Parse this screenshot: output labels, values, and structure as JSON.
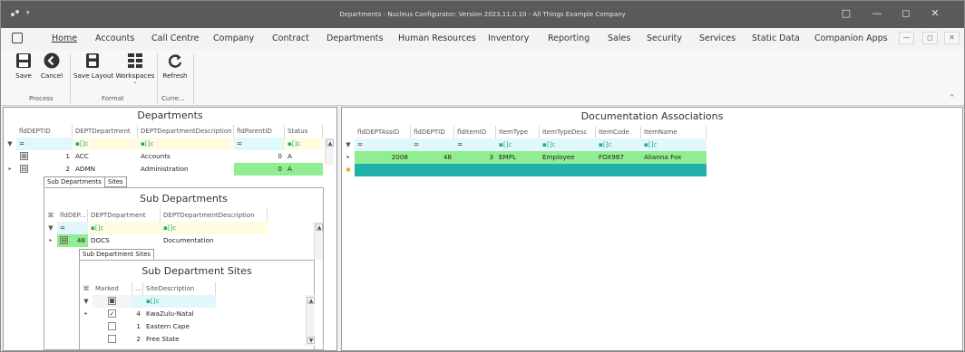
{
  "window": {
    "title": "Departments - Nucleus Configurator: Version 2023.11.0.10 - All Things Example Company",
    "controls": {
      "restore": "□",
      "minimize": "—",
      "maximize": "◻",
      "close": "✕"
    }
  },
  "menu": {
    "items": [
      "Home",
      "Accounts",
      "Call Centre",
      "Company",
      "Contract",
      "Departments",
      "Human Resources",
      "Inventory",
      "Reporting",
      "Sales",
      "Security",
      "Services",
      "Static Data",
      "Companion Apps"
    ],
    "mdi": [
      "—",
      "◻",
      "✕"
    ]
  },
  "ribbon": {
    "buttons": {
      "save": "Save",
      "cancel": "Cancel",
      "save_layout": "Save Layout",
      "workspaces": "Workspaces",
      "refresh": "Refresh"
    },
    "groups": {
      "process": "Process",
      "format": "Format",
      "current": "Curre..."
    },
    "collapse": "^"
  },
  "departments": {
    "title": "Departments",
    "columns": [
      "fldDEPTID",
      "DEPTDepartment",
      "DEPTDepartmentDescription",
      "fldParentID",
      "Status"
    ],
    "filter": {
      "eq": "=",
      "abc": "▪[]c"
    },
    "rows": [
      {
        "id": "1",
        "dept": "ACC",
        "desc": "Accounts",
        "parent": "0",
        "status": "A"
      },
      {
        "id": "2",
        "dept": "ADMN",
        "desc": "Administration",
        "parent": "0",
        "status": "A"
      }
    ],
    "expanders": [
      "⊞",
      "⊟"
    ]
  },
  "sub_tabs": {
    "sub_departments": "Sub Departments",
    "sites": "Sites"
  },
  "sub_departments": {
    "title": "Sub Departments",
    "columns": [
      "fldDEP...",
      "DEPTDepartment",
      "DEPTDepartmentDescription"
    ],
    "rows": [
      {
        "id": "48",
        "dept": "DOCS",
        "desc": "Documentation"
      }
    ]
  },
  "sub_dept_sites_tab": "Sub Department Sites",
  "sub_department_sites": {
    "title": "Sub Department Sites",
    "columns": [
      "Marked",
      "...",
      "SiteDescription"
    ],
    "rows": [
      {
        "marked": true,
        "num": "4",
        "desc": "KwaZulu-Natal"
      },
      {
        "marked": false,
        "num": "1",
        "desc": "Eastern Cape"
      },
      {
        "marked": false,
        "num": "2",
        "desc": "Free State"
      }
    ]
  },
  "documentation": {
    "title": "Documentation Associations",
    "columns": [
      "fldDEPTAssID",
      "fldDEPTID",
      "fldItemID",
      "ItemType",
      "ItemTypeDesc",
      "ItemCode",
      "ItemName"
    ],
    "rows": [
      {
        "assid": "2008",
        "deptid": "48",
        "itemid": "3",
        "type": "EMPL",
        "typedesc": "Employee",
        "code": "FOX967",
        "name": "Alianna Fox"
      }
    ],
    "new_row_marker": "✱"
  },
  "colors": {
    "green": "#90ee90",
    "filter_yellow": "#fffce0",
    "filter_cyan": "#e0f8fb",
    "new_row": "#20b2aa",
    "titlebar": "#5a5a5a"
  }
}
